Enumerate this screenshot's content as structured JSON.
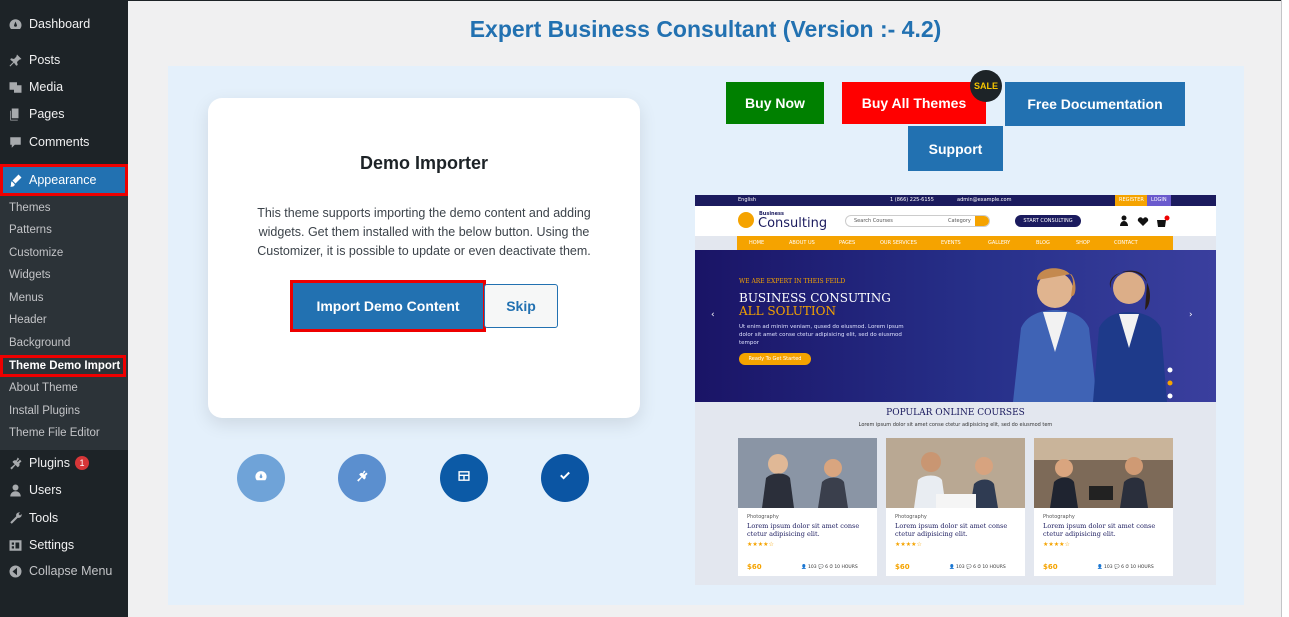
{
  "sidebar": {
    "top_items": [
      {
        "label": "Dashboard",
        "icon": "dashboard-icon"
      },
      {
        "label": "Posts",
        "icon": "pin-icon"
      },
      {
        "label": "Media",
        "icon": "media-icon"
      },
      {
        "label": "Pages",
        "icon": "pages-icon"
      },
      {
        "label": "Comments",
        "icon": "comment-icon"
      },
      {
        "label": "Appearance",
        "icon": "brush-icon"
      }
    ],
    "submenu": [
      "Themes",
      "Patterns",
      "Customize",
      "Widgets",
      "Menus",
      "Header",
      "Background",
      "Theme Demo Import",
      "About Theme",
      "Install Plugins",
      "Theme File Editor"
    ],
    "bottom_items": [
      {
        "label": "Plugins",
        "icon": "plugin-icon",
        "badge": "1"
      },
      {
        "label": "Users",
        "icon": "user-icon"
      },
      {
        "label": "Tools",
        "icon": "wrench-icon"
      },
      {
        "label": "Settings",
        "icon": "settings-icon"
      },
      {
        "label": "Collapse Menu",
        "icon": "collapse-icon"
      }
    ]
  },
  "page": {
    "title": "Expert Business Consultant (Version :- 4.2)"
  },
  "card": {
    "title": "Demo Importer",
    "description": "This theme supports importing the demo content and adding widgets. Get them installed with the below button. Using the Customizer, it is possible to update or even deactivate them.",
    "import_label": "Import Demo Content",
    "skip_label": "Skip"
  },
  "steps": [
    {
      "icon": "gauge-icon",
      "color": "#6fa3d8"
    },
    {
      "icon": "plugin-icon",
      "color": "#5b8fcf"
    },
    {
      "icon": "layout-icon",
      "color": "#0c5aa6"
    },
    {
      "icon": "check-icon",
      "color": "#0b55a3"
    }
  ],
  "actions": {
    "buy_now": "Buy Now",
    "buy_all": "Buy All Themes",
    "sale": "SALE",
    "docs": "Free Documentation",
    "support": "Support"
  },
  "colors": {
    "buy_now": "#008000",
    "buy_all": "#ff0000",
    "docs": "#2271b1",
    "support": "#2271b1"
  },
  "preview": {
    "topbar": {
      "lang": "English",
      "phone": "1 (866) 225-6155",
      "email": "admin@example.com",
      "register": "REGISTER",
      "login": "LOGIN"
    },
    "logo_small": "Business",
    "logo": "Consulting",
    "search_placeholder": "Search Courses",
    "category": "Category",
    "start": "START CONSULTING",
    "nav": [
      "HOME",
      "ABOUT US",
      "PAGES",
      "OUR SERVICES",
      "EVENTS",
      "GALLERY",
      "BLOG",
      "SHOP",
      "CONTACT"
    ],
    "hero": {
      "kicker": "WE ARE EXPERT IN THEIS FEILD",
      "title1": "BUSINESS CONSUTING",
      "title2": "ALL SOLUTION",
      "text": "Ut enim ad minim veniam, qused do eiusmod. Lorem ipsum dolor sit amet conse ctetur adipisicing elit, sed do eiusmod tempor",
      "button": "Ready To Get Started"
    },
    "courses_title": "POPULAR ONLINE COURSES",
    "courses_sub": "Lorem ipsum dolor sit amet conse ctetur adipisicing elit, sed do eiusmod tem",
    "courses": [
      {
        "category": "Photography",
        "title": "Lorem ipsum dolor sit amet conse ctetur adipisicing elit.",
        "stars": "★★★★☆",
        "price": "$60",
        "meta": "👤 103  💬 6  ⏱ 10 HOURS"
      },
      {
        "category": "Photography",
        "title": "Lorem ipsum dolor sit amet conse ctetur adipisicing elit.",
        "stars": "★★★★☆",
        "price": "$60",
        "meta": "👤 103  💬 6  ⏱ 10 HOURS"
      },
      {
        "category": "Photography",
        "title": "Lorem ipsum dolor sit amet conse ctetur adipisicing elit.",
        "stars": "★★★★☆",
        "price": "$60",
        "meta": "👤 103  💬 6  ⏱ 10 HOURS"
      }
    ]
  }
}
